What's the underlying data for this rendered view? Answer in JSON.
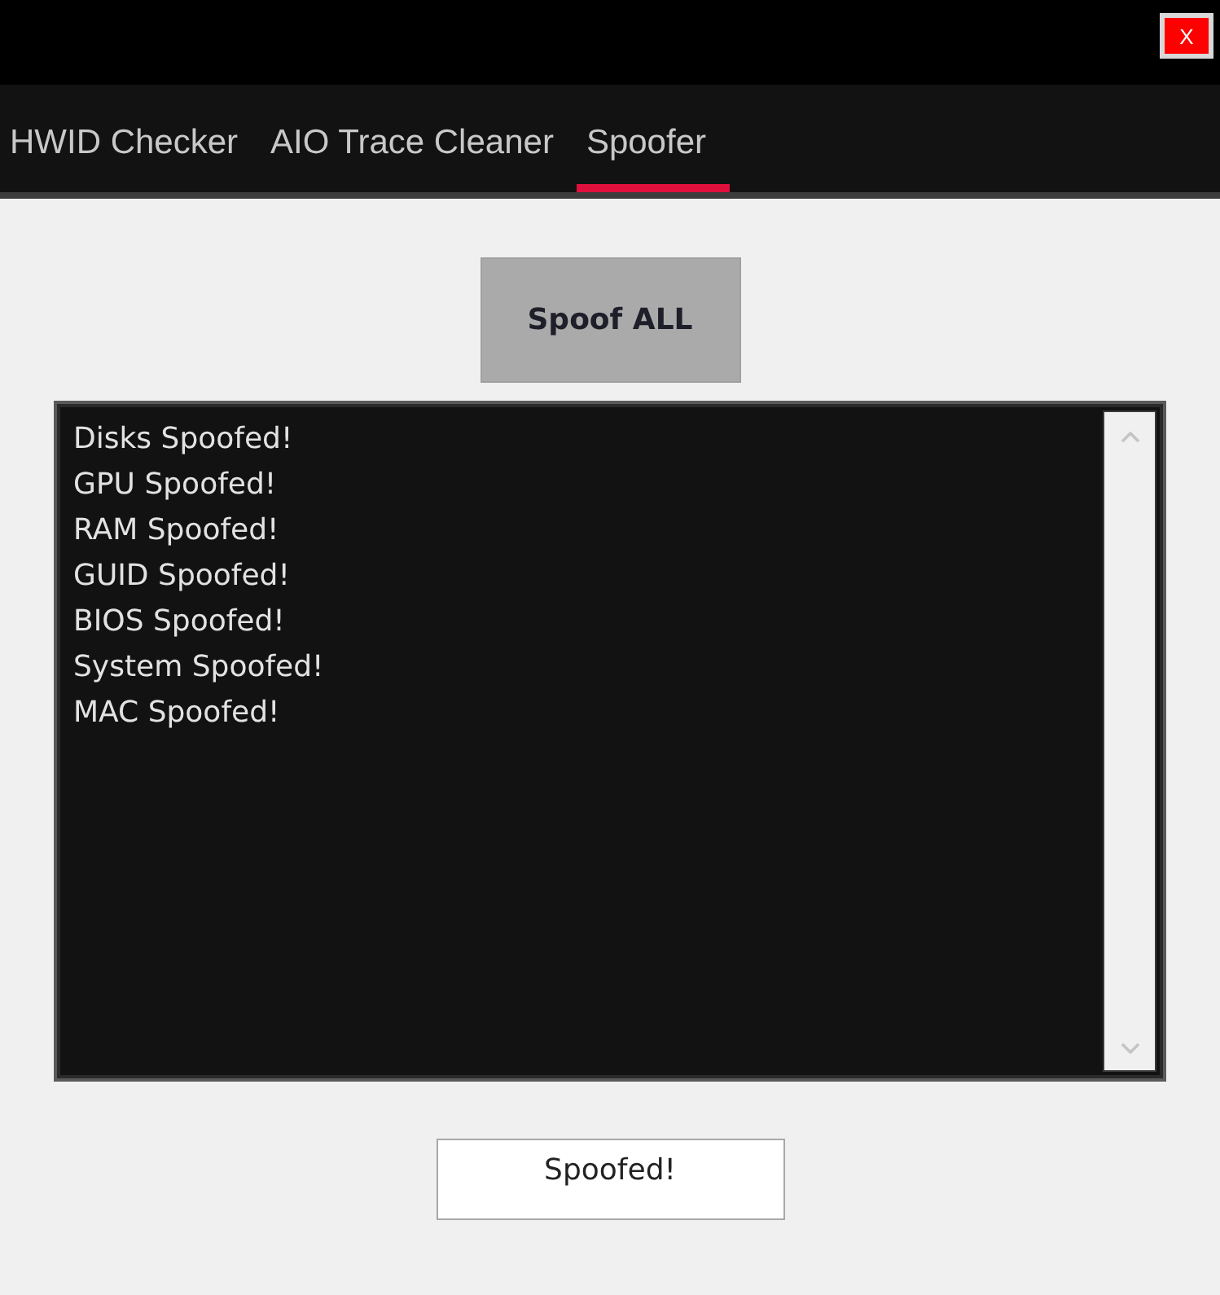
{
  "window": {
    "close_label": "X"
  },
  "tabs": [
    {
      "label": "HWID Checker",
      "selected": false
    },
    {
      "label": "AIO Trace Cleaner",
      "selected": false
    },
    {
      "label": "Spoofer",
      "selected": true
    }
  ],
  "spoof_button": {
    "label": "Spoof ALL"
  },
  "log": {
    "lines": [
      "Disks Spoofed!",
      "GPU Spoofed!",
      "RAM Spoofed!",
      "GUID Spoofed!",
      "BIOS Spoofed!",
      "System Spoofed!",
      "MAC Spoofed!"
    ]
  },
  "status_field": {
    "value": "Spoofed!"
  }
}
